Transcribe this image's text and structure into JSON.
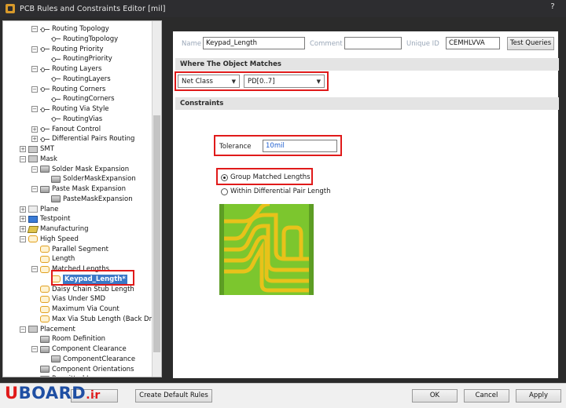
{
  "window": {
    "title": "PCB Rules and Constraints Editor [mil]",
    "help": "?"
  },
  "tree": {
    "items": [
      {
        "label": "Routing Topology",
        "indent": 2,
        "exp": "−",
        "icon": "route-icon"
      },
      {
        "label": "RoutingTopology",
        "indent": 3,
        "exp": "",
        "icon": "route-icon"
      },
      {
        "label": "Routing Priority",
        "indent": 2,
        "exp": "−",
        "icon": "route-icon"
      },
      {
        "label": "RoutingPriority",
        "indent": 3,
        "exp": "",
        "icon": "route-icon"
      },
      {
        "label": "Routing Layers",
        "indent": 2,
        "exp": "−",
        "icon": "route-icon"
      },
      {
        "label": "RoutingLayers",
        "indent": 3,
        "exp": "",
        "icon": "route-icon"
      },
      {
        "label": "Routing Corners",
        "indent": 2,
        "exp": "−",
        "icon": "route-icon"
      },
      {
        "label": "RoutingCorners",
        "indent": 3,
        "exp": "",
        "icon": "route-icon"
      },
      {
        "label": "Routing Via Style",
        "indent": 2,
        "exp": "−",
        "icon": "route-icon"
      },
      {
        "label": "RoutingVias",
        "indent": 3,
        "exp": "",
        "icon": "route-icon"
      },
      {
        "label": "Fanout Control",
        "indent": 2,
        "exp": "+",
        "icon": "route-icon"
      },
      {
        "label": "Differential Pairs Routing",
        "indent": 2,
        "exp": "+",
        "icon": "route-icon"
      },
      {
        "label": "SMT",
        "indent": 1,
        "exp": "+",
        "icon": "smt-icon"
      },
      {
        "label": "Mask",
        "indent": 1,
        "exp": "−",
        "icon": "mask-icon"
      },
      {
        "label": "Solder Mask Expansion",
        "indent": 2,
        "exp": "−",
        "icon": "rule-icon"
      },
      {
        "label": "SolderMaskExpansion",
        "indent": 3,
        "exp": "",
        "icon": "rule-icon"
      },
      {
        "label": "Paste Mask Expansion",
        "indent": 2,
        "exp": "−",
        "icon": "rule-icon"
      },
      {
        "label": "PasteMaskExpansion",
        "indent": 3,
        "exp": "",
        "icon": "rule-icon"
      },
      {
        "label": "Plane",
        "indent": 1,
        "exp": "+",
        "icon": "plane-icon"
      },
      {
        "label": "Testpoint",
        "indent": 1,
        "exp": "+",
        "icon": "testpoint-icon"
      },
      {
        "label": "Manufacturing",
        "indent": 1,
        "exp": "+",
        "icon": "manufacturing-icon"
      },
      {
        "label": "High Speed",
        "indent": 1,
        "exp": "−",
        "icon": "high-speed-icon"
      },
      {
        "label": "Parallel Segment",
        "indent": 2,
        "exp": "",
        "icon": "high-speed-icon"
      },
      {
        "label": "Length",
        "indent": 2,
        "exp": "",
        "icon": "high-speed-icon"
      },
      {
        "label": "Matched Lengths",
        "indent": 2,
        "exp": "−",
        "icon": "high-speed-icon"
      },
      {
        "label": "Keypad_Length*",
        "indent": 3,
        "exp": "",
        "icon": "high-speed-icon",
        "selected": true
      },
      {
        "label": "Daisy Chain Stub Length",
        "indent": 2,
        "exp": "",
        "icon": "high-speed-icon"
      },
      {
        "label": "Vias Under SMD",
        "indent": 2,
        "exp": "",
        "icon": "high-speed-icon"
      },
      {
        "label": "Maximum Via Count",
        "indent": 2,
        "exp": "",
        "icon": "high-speed-icon"
      },
      {
        "label": "Max Via Stub Length (Back Dri",
        "indent": 2,
        "exp": "",
        "icon": "high-speed-icon"
      },
      {
        "label": "Placement",
        "indent": 1,
        "exp": "−",
        "icon": "placement-icon"
      },
      {
        "label": "Room Definition",
        "indent": 2,
        "exp": "",
        "icon": "rule-icon"
      },
      {
        "label": "Component Clearance",
        "indent": 2,
        "exp": "−",
        "icon": "rule-icon"
      },
      {
        "label": "ComponentClearance",
        "indent": 3,
        "exp": "",
        "icon": "rule-icon"
      },
      {
        "label": "Component Orientations",
        "indent": 2,
        "exp": "",
        "icon": "rule-icon"
      },
      {
        "label": "Permitted Layers",
        "indent": 2,
        "exp": "",
        "icon": "rule-icon"
      }
    ]
  },
  "rule": {
    "name_label": "Name",
    "name_value": "Keypad_Length",
    "comment_label": "Comment",
    "comment_value": "",
    "uid_label": "Unique ID",
    "uid_value": "CEMHLVVA",
    "test_queries": "Test Queries"
  },
  "match": {
    "header": "Where The Object Matches",
    "type_value": "Net Class",
    "class_value": "PD[0..7]"
  },
  "constraints": {
    "header": "Constraints",
    "tolerance_label": "Tolerance",
    "tolerance_value": "10mil",
    "option_group": "Group Matched Lengths",
    "option_diff": "Within Differential Pair Length",
    "selected_option": "Group Matched Lengths"
  },
  "footer": {
    "rule_wizard": "...",
    "create_default_rules": "Create Default Rules",
    "ok": "OK",
    "cancel": "Cancel",
    "apply": "Apply"
  },
  "logo": {
    "u": "U",
    "board": "BOARD",
    "ir": ".ir"
  },
  "colors": {
    "highlight": "#e01a1a",
    "selection": "#3b78c7",
    "pcb_green": "#7cc62e",
    "trace_yellow": "#e8c21a"
  }
}
